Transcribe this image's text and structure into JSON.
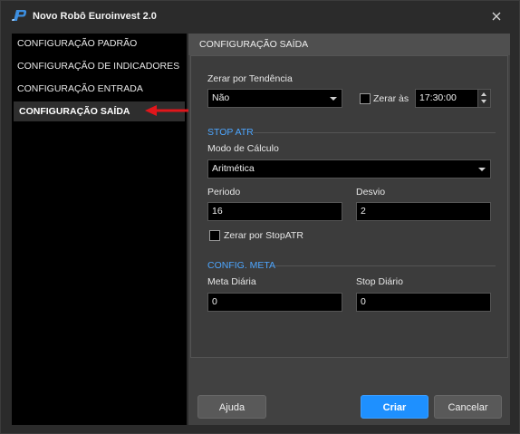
{
  "window": {
    "title": "Novo Robô Euroinvest 2.0",
    "close_glyph": "✕",
    "logo_icon": "robot-p-logo-icon"
  },
  "sidebar": {
    "items": [
      {
        "label": "CONFIGURAÇÃO PADRÃO",
        "active": false
      },
      {
        "label": "CONFIGURAÇÃO DE INDICADORES",
        "active": false
      },
      {
        "label": "CONFIGURAÇÃO ENTRADA",
        "active": false
      },
      {
        "label": "CONFIGURAÇÃO SAÍDA",
        "active": true
      }
    ],
    "pointer_icon": "red-arrow-icon"
  },
  "main": {
    "header": "CONFIGURAÇÃO SAÍDA",
    "zerar_tendencia": {
      "label": "Zerar por Tendência",
      "value": "Não"
    },
    "zerar_as": {
      "label": "Zerar às",
      "checked": false,
      "time": "17:30:00"
    },
    "stop_atr": {
      "section_label": "STOP ATR",
      "modo_label": "Modo de Cálculo",
      "modo_value": "Aritmética",
      "periodo_label": "Periodo",
      "periodo_value": "16",
      "desvio_label": "Desvio",
      "desvio_value": "2",
      "zerar_stopatr_label": "Zerar por StopATR",
      "zerar_stopatr_checked": false
    },
    "config_meta": {
      "section_label": "CONFIG. META",
      "meta_label": "Meta Diária",
      "meta_value": "0",
      "stop_label": "Stop Diário",
      "stop_value": "0"
    }
  },
  "buttons": {
    "help": "Ajuda",
    "create": "Criar",
    "cancel": "Cancelar"
  },
  "colors": {
    "accent": "#1e90ff",
    "section_label": "#4da6ff",
    "arrow": "#e0161b"
  }
}
